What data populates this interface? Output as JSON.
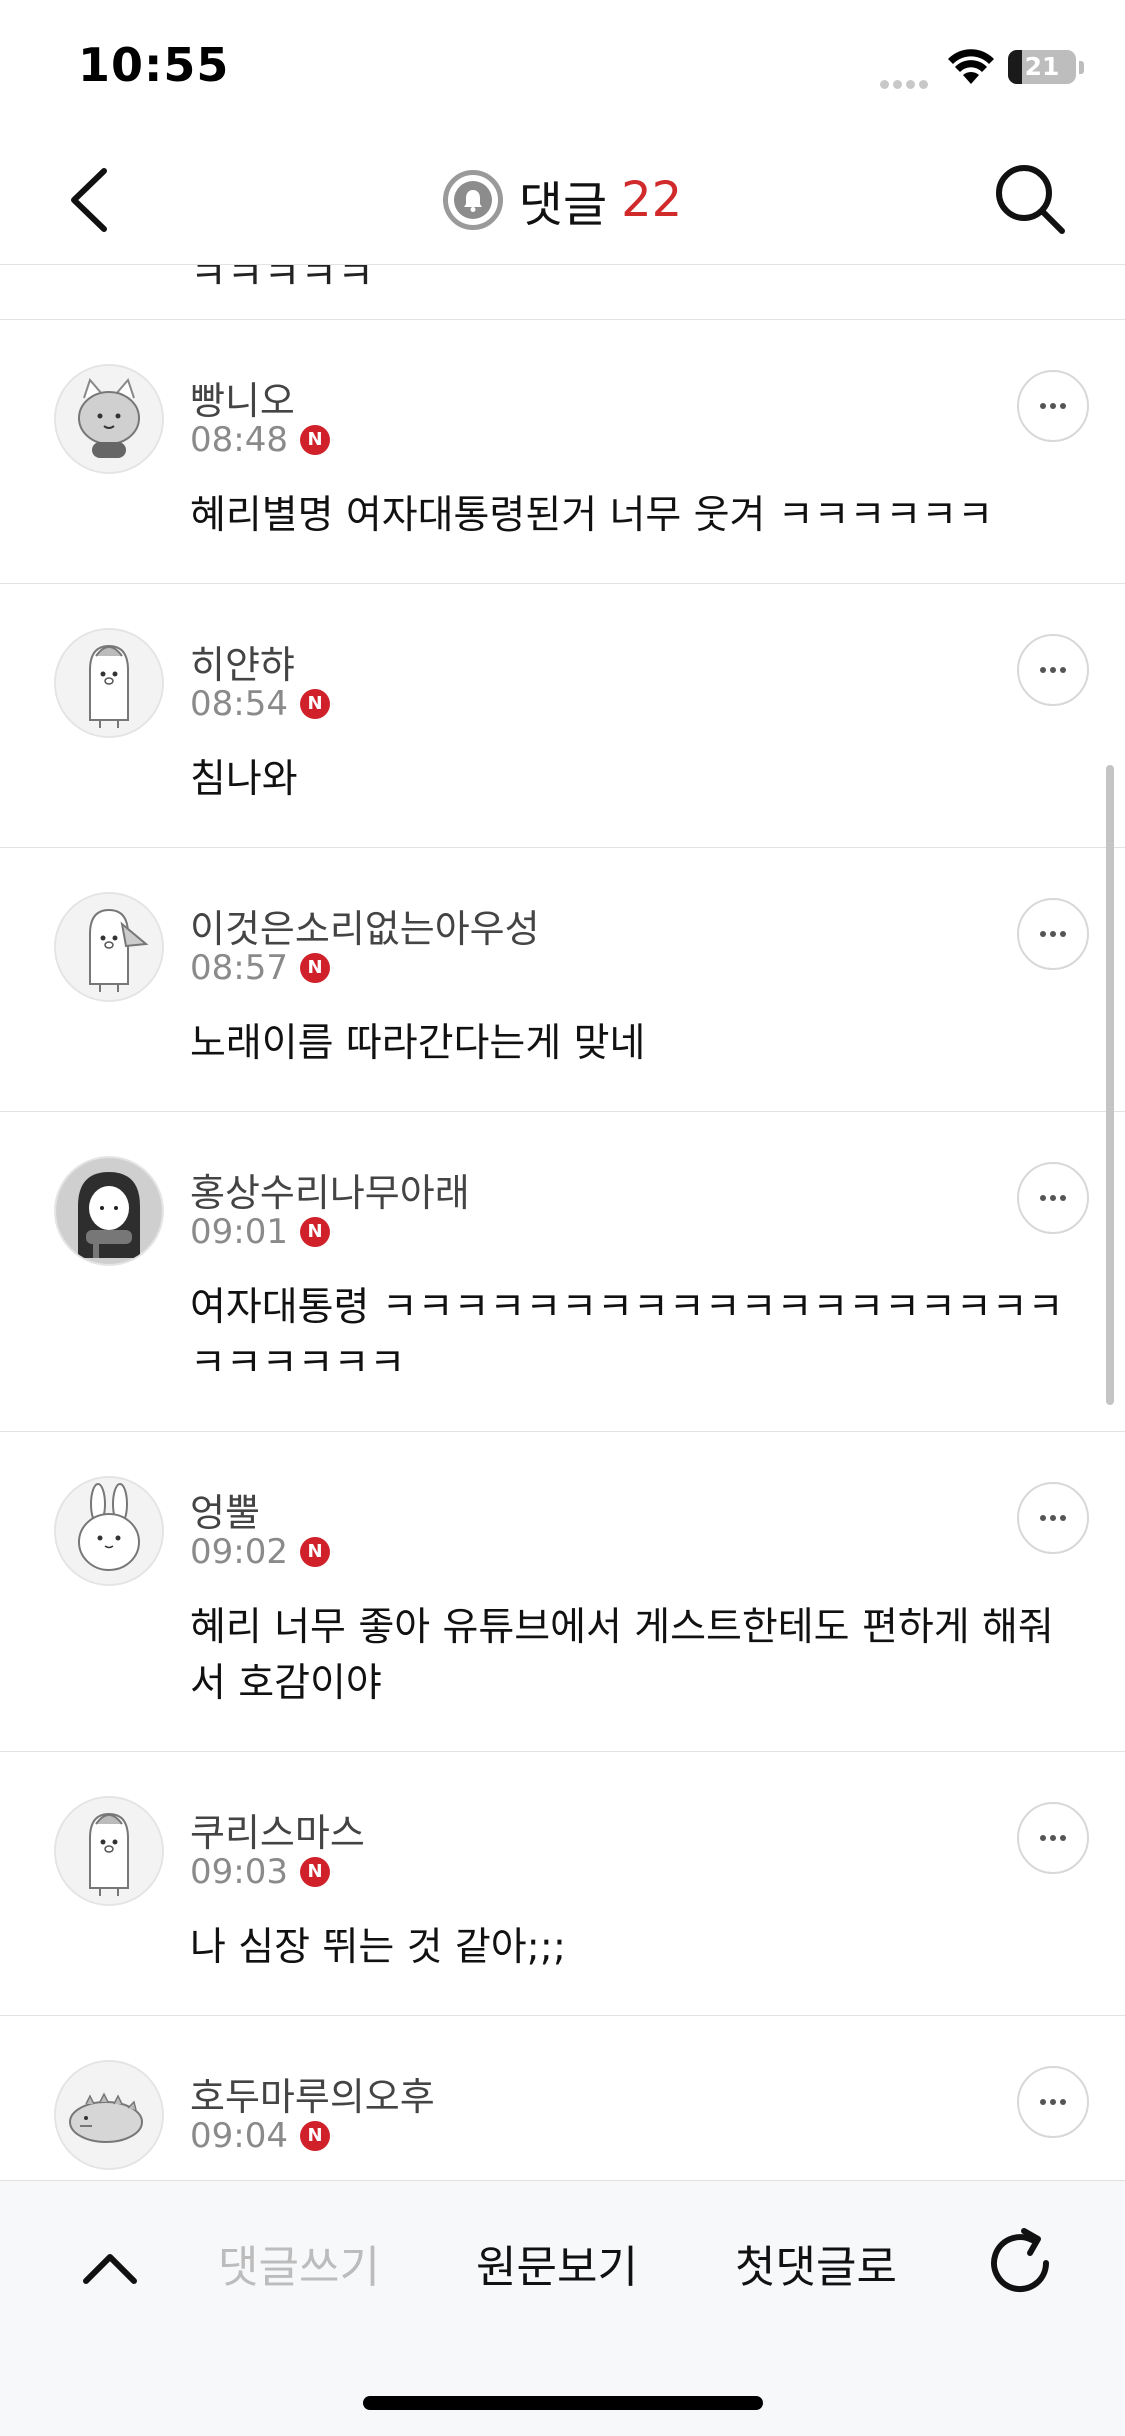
{
  "status_bar": {
    "time": "10:55",
    "battery": "21",
    "battery_level": 0.21
  },
  "header": {
    "title": "댓글",
    "count": "22",
    "accent_color": "#d02a2a"
  },
  "icons": {
    "back": "chevron-left-icon",
    "bell": "bell-icon",
    "search": "search-icon",
    "more": "more-horizontal-icon",
    "up": "chevron-up-icon",
    "refresh": "refresh-icon"
  },
  "comments": [
    {
      "author": "빵니오",
      "time": "08:48",
      "badge": "N",
      "text": "혜리별명 여자대통령된거 너무 웃겨 ㅋㅋㅋㅋㅋㅋ"
    },
    {
      "author": "히얀햐",
      "time": "08:54",
      "badge": "N",
      "text": "침나와"
    },
    {
      "author": "이것은소리없는아우성",
      "time": "08:57",
      "badge": "N",
      "text": "노래이름 따라간다는게 맞네"
    },
    {
      "author": "홍상수리나무아래",
      "time": "09:01",
      "badge": "N",
      "text": "여자대통령 ㅋㅋㅋㅋㅋㅋㅋㅋㅋㅋㅋㅋㅋㅋㅋㅋㅋㅋㅋㅋㅋㅋㅋㅋㅋ"
    },
    {
      "author": "엉뿔",
      "time": "09:02",
      "badge": "N",
      "text": "혜리 너무 좋아 유튜브에서 게스트한테도 편하게 해줘서 호감이야"
    },
    {
      "author": "쿠리스마스",
      "time": "09:03",
      "badge": "N",
      "text": "나 심장 뛰는 것 같아;;;"
    },
    {
      "author": "호두마루의오후",
      "time": "09:04",
      "badge": "N",
      "text": ""
    }
  ],
  "bottom_bar": {
    "write_comment": "댓글쓰기",
    "view_original": "원문보기",
    "first_comment": "첫댓글로"
  }
}
